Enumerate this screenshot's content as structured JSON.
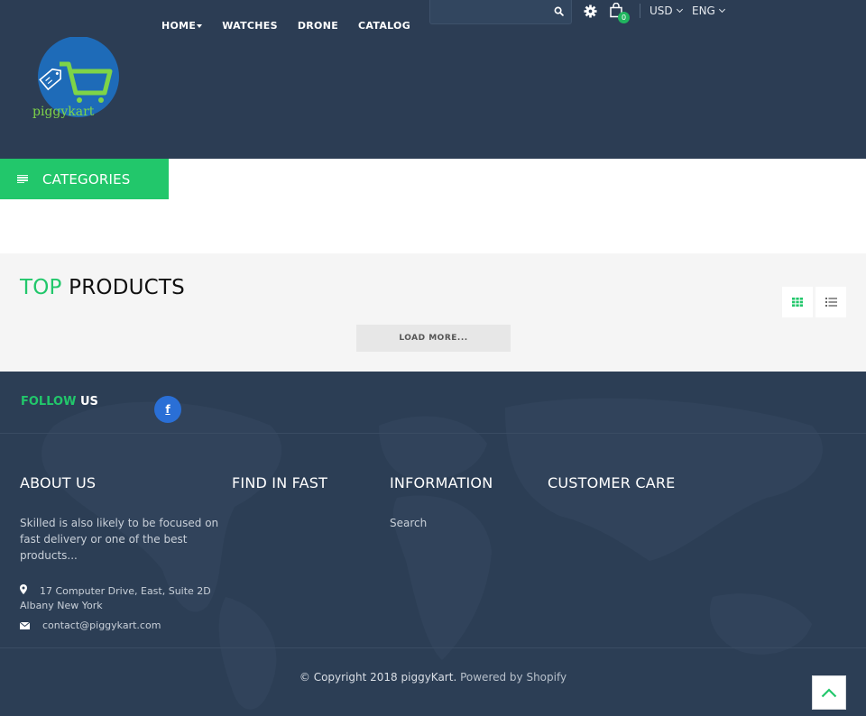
{
  "header": {
    "nav": [
      {
        "label": "HOME",
        "has_dropdown": true
      },
      {
        "label": "WATCHES",
        "has_dropdown": false
      },
      {
        "label": "DRONE",
        "has_dropdown": false
      },
      {
        "label": "CATALOG",
        "has_dropdown": false
      }
    ],
    "search": {
      "value": "",
      "placeholder": ""
    },
    "cart_count": "0",
    "currency": "USD",
    "language": "ENG",
    "logo_text": "piggykart"
  },
  "categories": {
    "label": "CATEGORIES"
  },
  "products": {
    "title_accent": "TOP",
    "title_rest": "PRODUCTS",
    "load_more_label": "LOAD MORE...",
    "active_view": "grid"
  },
  "footer": {
    "follow_accent": "FOLLOW",
    "follow_rest": "US",
    "social": [
      {
        "name": "facebook",
        "glyph": "f"
      }
    ],
    "columns": [
      {
        "title": "ABOUT US"
      },
      {
        "title": "FIND IN FAST"
      },
      {
        "title": "INFORMATION"
      },
      {
        "title": "CUSTOMER CARE"
      }
    ],
    "about_text": "Skilled is also likely to be focused on fast delivery or one of the best products...",
    "address": "17 Computer Drive, East, Suite 2D Albany New York",
    "email": "contact@piggykart.com",
    "information_links": [
      "Search"
    ],
    "copyright_main": "© Copyright 2018 piggyKart.",
    "copyright_powered": "Powered by Shopify"
  },
  "colors": {
    "header_bg": "#2c3d54",
    "accent_green": "#22c76b",
    "facebook_blue": "#2a6fd6",
    "products_bg": "#f5f5f5"
  }
}
